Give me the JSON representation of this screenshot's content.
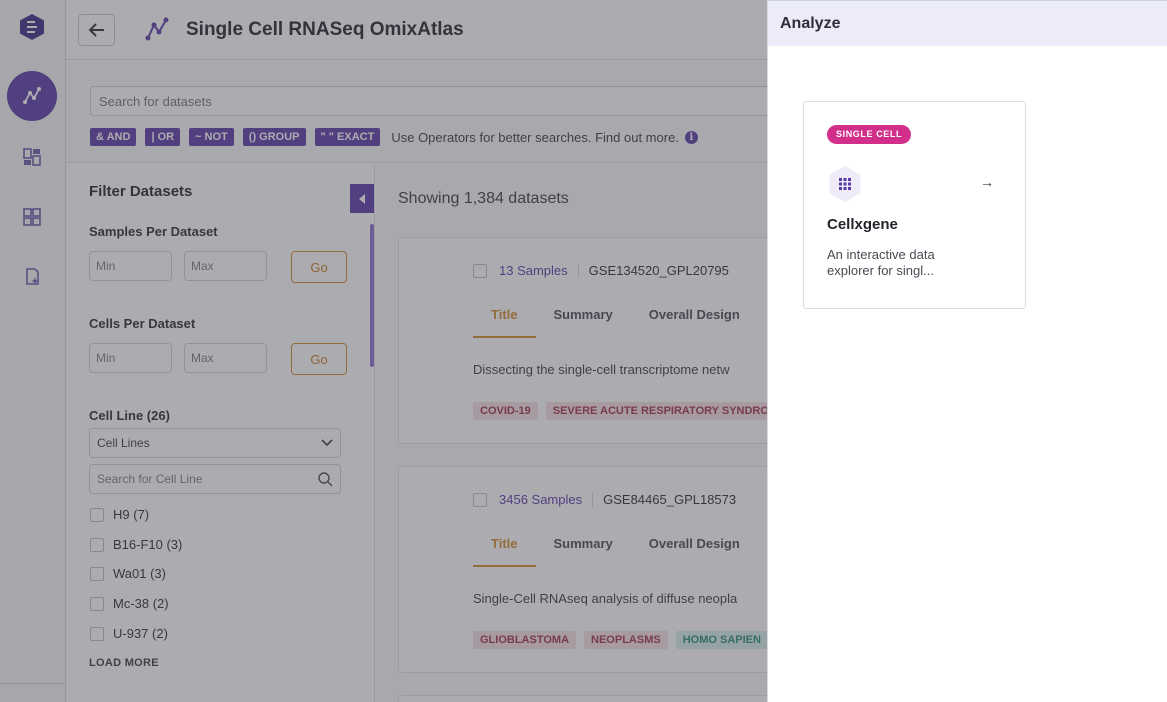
{
  "header": {
    "title": "Single Cell RNASeq OmixAtlas"
  },
  "search": {
    "placeholder": "Search for datasets",
    "operators": [
      "& AND",
      "| OR",
      "~ NOT",
      "() GROUP",
      "\" \" EXACT"
    ],
    "hint": "Use Operators for better searches. Find out more."
  },
  "filters": {
    "title": "Filter Datasets",
    "samples_per_dataset": {
      "label": "Samples Per Dataset",
      "min_placeholder": "Min",
      "max_placeholder": "Max",
      "go_label": "Go"
    },
    "cells_per_dataset": {
      "label": "Cells Per Dataset",
      "min_placeholder": "Min",
      "max_placeholder": "Max",
      "go_label": "Go"
    },
    "cell_line": {
      "label": "Cell Line (26)",
      "select_value": "Cell Lines",
      "search_placeholder": "Search for Cell Line",
      "options": [
        "H9 (7)",
        "B16-F10 (3)",
        "Wa01 (3)",
        "Mc-38 (2)",
        "U-937 (2)"
      ],
      "load_more": "LOAD MORE"
    }
  },
  "results": {
    "showing": "Showing 1,384 datasets",
    "cards": [
      {
        "samples": "13 Samples",
        "gse": "GSE134520_GPL20795",
        "tabs": [
          "Title",
          "Summary",
          "Overall Design"
        ],
        "desc": "Dissecting the single-cell transcriptome netw",
        "tags": [
          {
            "text": "COVID-19",
            "color": "red"
          },
          {
            "text": "SEVERE ACUTE RESPIRATORY SYNDRO",
            "color": "red"
          }
        ]
      },
      {
        "samples": "3456 Samples",
        "gse": "GSE84465_GPL18573",
        "tabs": [
          "Title",
          "Summary",
          "Overall Design"
        ],
        "desc": "Single-Cell RNAseq analysis of diffuse neopla",
        "tags": [
          {
            "text": "GLIOBLASTOMA",
            "color": "red"
          },
          {
            "text": "NEOPLASMS",
            "color": "red"
          },
          {
            "text": "HOMO SAPIEN",
            "color": "teal"
          }
        ]
      }
    ]
  },
  "drawer": {
    "title": "Analyze",
    "tool": {
      "badge": "SINGLE CELL",
      "name": "Cellxgene",
      "desc": "An interactive data explorer for singl..."
    }
  },
  "colors": {
    "accent": "#5a3aa8",
    "orange": "#d08a2a",
    "badge_pink": "#d12f8a"
  }
}
